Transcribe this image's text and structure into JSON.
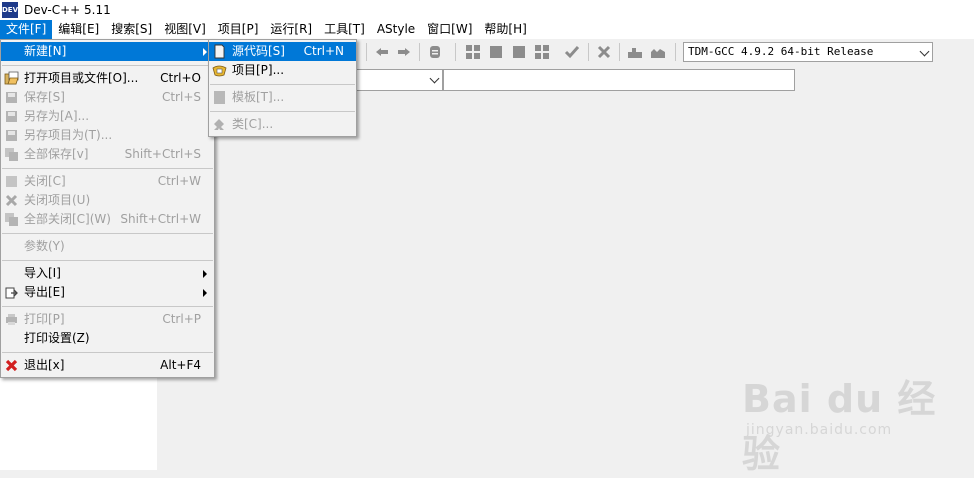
{
  "window": {
    "title": "Dev-C++ 5.11",
    "app_icon_text": "DEV"
  },
  "menubar": [
    "文件[F]",
    "编辑[E]",
    "搜索[S]",
    "视图[V]",
    "项目[P]",
    "运行[R]",
    "工具[T]",
    "AStyle",
    "窗口[W]",
    "帮助[H]"
  ],
  "toolbar": {
    "compiler": "TDM-GCC 4.9.2 64-bit Release"
  },
  "file_menu": [
    {
      "label": "新建[N]",
      "shortcut": "",
      "submenu": true,
      "state": "highlighted",
      "icon": ""
    },
    {
      "separator": true
    },
    {
      "label": "打开项目或文件[O]...",
      "shortcut": "Ctrl+O",
      "state": "enabled",
      "icon": "open-folder-icon"
    },
    {
      "label": "保存[S]",
      "shortcut": "Ctrl+S",
      "state": "disabled",
      "icon": "save-icon"
    },
    {
      "label": "另存为[A]...",
      "shortcut": "",
      "state": "disabled",
      "icon": "save-as-icon"
    },
    {
      "label": "另存项目为(T)...",
      "shortcut": "",
      "state": "disabled",
      "icon": "save-project-icon"
    },
    {
      "label": "全部保存[v]",
      "shortcut": "Shift+Ctrl+S",
      "state": "disabled",
      "icon": "save-all-icon"
    },
    {
      "separator": true
    },
    {
      "label": "关闭[C]",
      "shortcut": "Ctrl+W",
      "state": "disabled",
      "icon": "close-file-icon"
    },
    {
      "label": "关闭项目(U)",
      "shortcut": "",
      "state": "disabled",
      "icon": "close-project-icon"
    },
    {
      "label": "全部关闭[C](W)",
      "shortcut": "Shift+Ctrl+W",
      "state": "disabled",
      "icon": "close-all-icon"
    },
    {
      "separator": true
    },
    {
      "label": "参数(Y)",
      "shortcut": "",
      "state": "disabled",
      "icon": ""
    },
    {
      "separator": true
    },
    {
      "label": "导入[I]",
      "shortcut": "",
      "submenu": true,
      "state": "enabled",
      "icon": ""
    },
    {
      "label": "导出[E]",
      "shortcut": "",
      "submenu": true,
      "state": "enabled",
      "icon": "export-icon"
    },
    {
      "separator": true
    },
    {
      "label": "打印[P]",
      "shortcut": "Ctrl+P",
      "state": "disabled",
      "icon": "print-icon"
    },
    {
      "label": "打印设置(Z)",
      "shortcut": "",
      "state": "enabled",
      "icon": ""
    },
    {
      "separator": true
    },
    {
      "label": "退出[x]",
      "shortcut": "Alt+F4",
      "state": "enabled",
      "icon": "exit-icon"
    }
  ],
  "new_submenu": [
    {
      "label": "源代码[S]",
      "shortcut": "Ctrl+N",
      "state": "highlighted",
      "icon": "source-file-icon"
    },
    {
      "label": "项目[P]...",
      "shortcut": "",
      "state": "enabled",
      "icon": "project-icon"
    },
    {
      "separator": true
    },
    {
      "label": "模板[T]...",
      "shortcut": "",
      "state": "disabled",
      "icon": "template-icon"
    },
    {
      "separator": true
    },
    {
      "label": "类[C]...",
      "shortcut": "",
      "state": "disabled",
      "icon": "class-icon"
    }
  ],
  "watermark": {
    "main": "Bai du 经验",
    "sub": "jingyan.baidu.com"
  }
}
